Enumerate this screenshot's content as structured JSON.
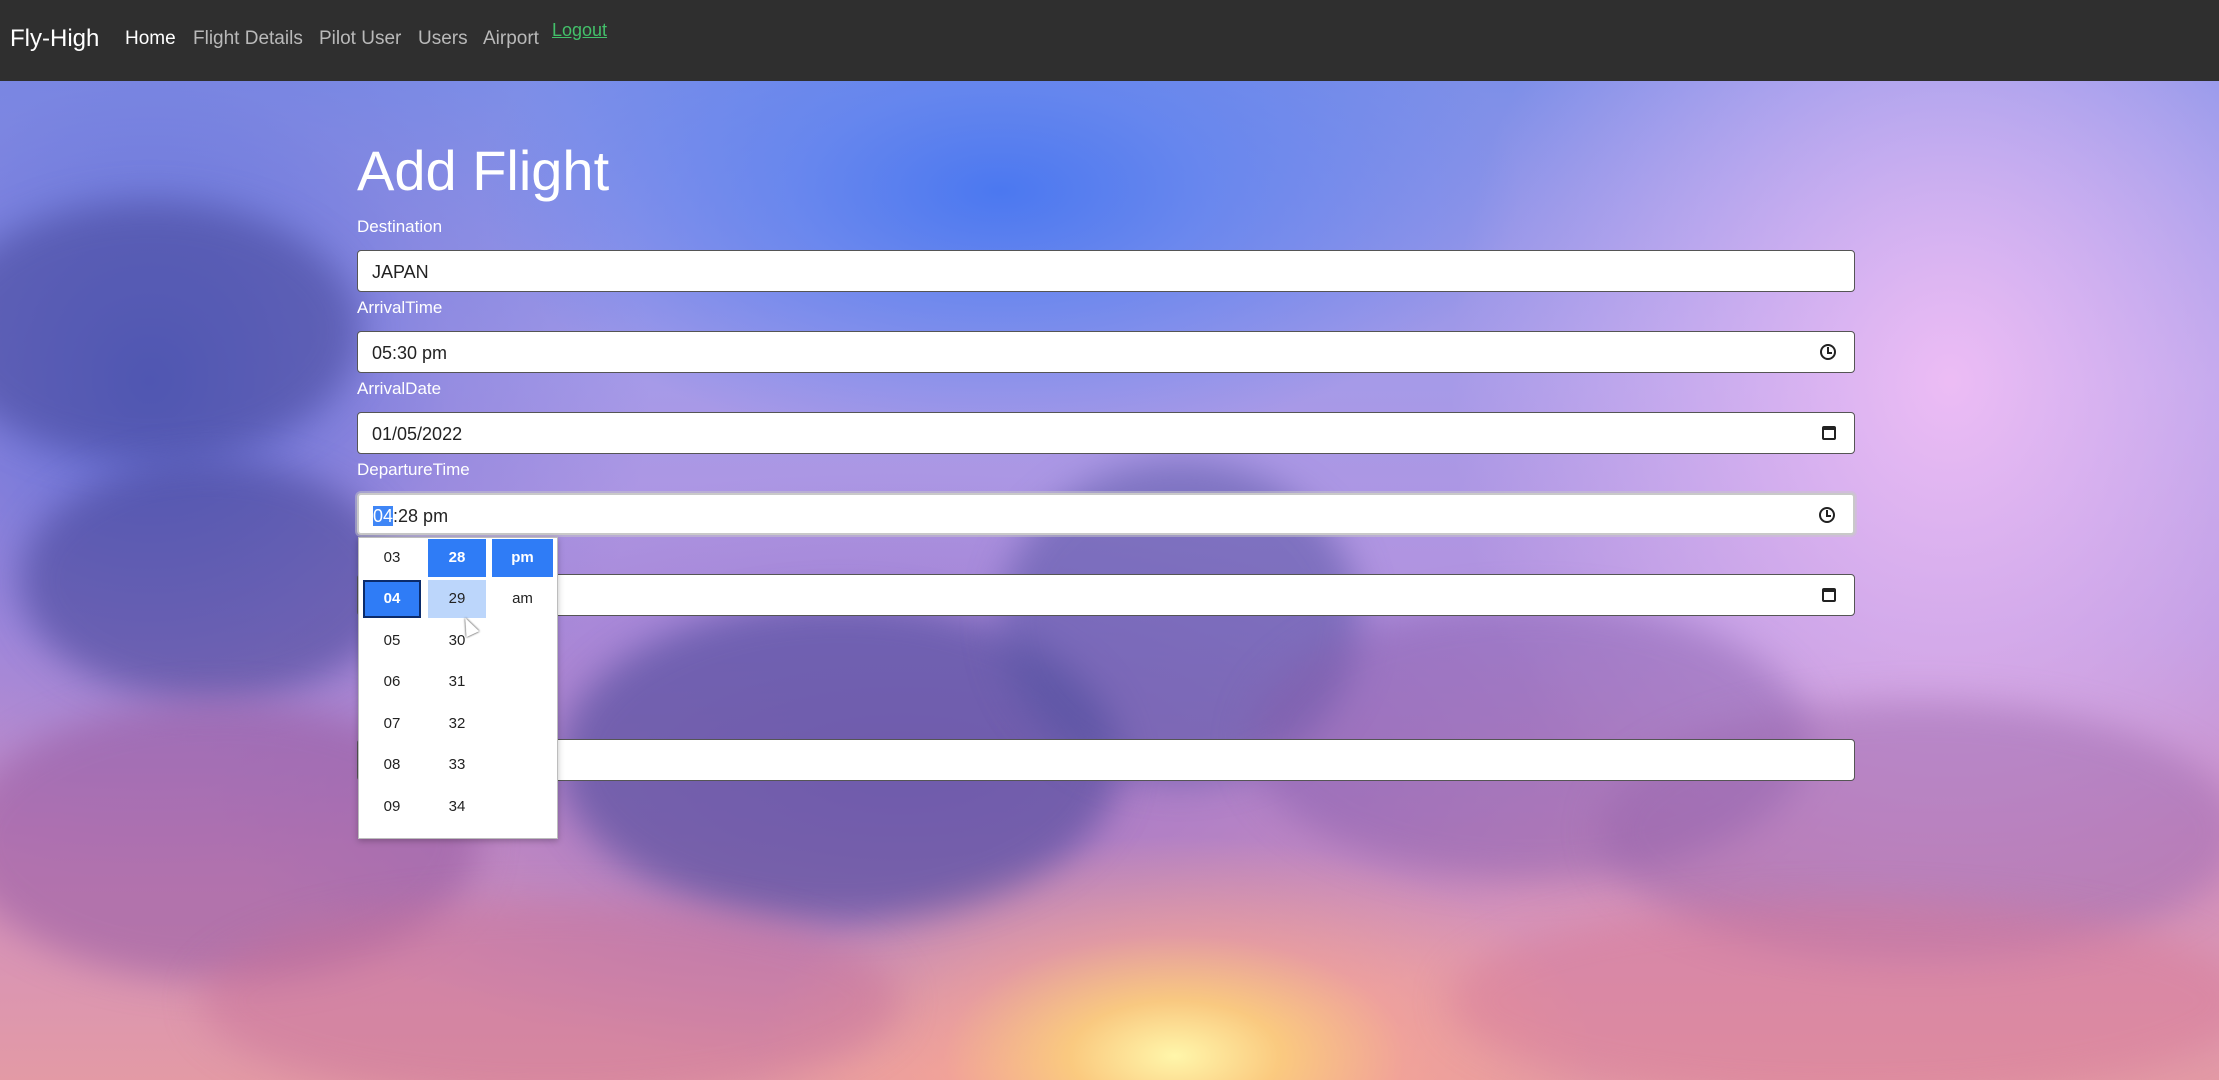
{
  "navbar": {
    "brand": "Fly-High",
    "items": [
      {
        "label": "Home",
        "active": true
      },
      {
        "label": "Flight Details",
        "active": false
      },
      {
        "label": "Pilot User",
        "active": false
      },
      {
        "label": "Users",
        "active": false
      },
      {
        "label": "Airport",
        "active": false
      }
    ],
    "logout": "Logout"
  },
  "form": {
    "title": "Add Flight",
    "destination": {
      "label": "Destination",
      "value": "JAPAN"
    },
    "arrival_time": {
      "label": "ArrivalTime",
      "value": "05:30 pm"
    },
    "arrival_date": {
      "label": "ArrivalDate",
      "value": "01/05/2022"
    },
    "departure_time": {
      "label": "DepartureTime",
      "value_hour": "04",
      "value_rest": ":28 pm"
    }
  },
  "time_picker": {
    "hours": [
      "03",
      "04",
      "05",
      "06",
      "07",
      "08",
      "09"
    ],
    "minutes": [
      "28",
      "29",
      "30",
      "31",
      "32",
      "33",
      "34"
    ],
    "periods": [
      "pm",
      "am"
    ],
    "selected_hour": "04",
    "selected_minute": "28",
    "selected_period": "pm",
    "hovered_minute": "29"
  },
  "colors": {
    "navbar_bg": "#2f2f2f",
    "logout_link": "#43c06a",
    "selection_blue": "#2f7cf6"
  }
}
